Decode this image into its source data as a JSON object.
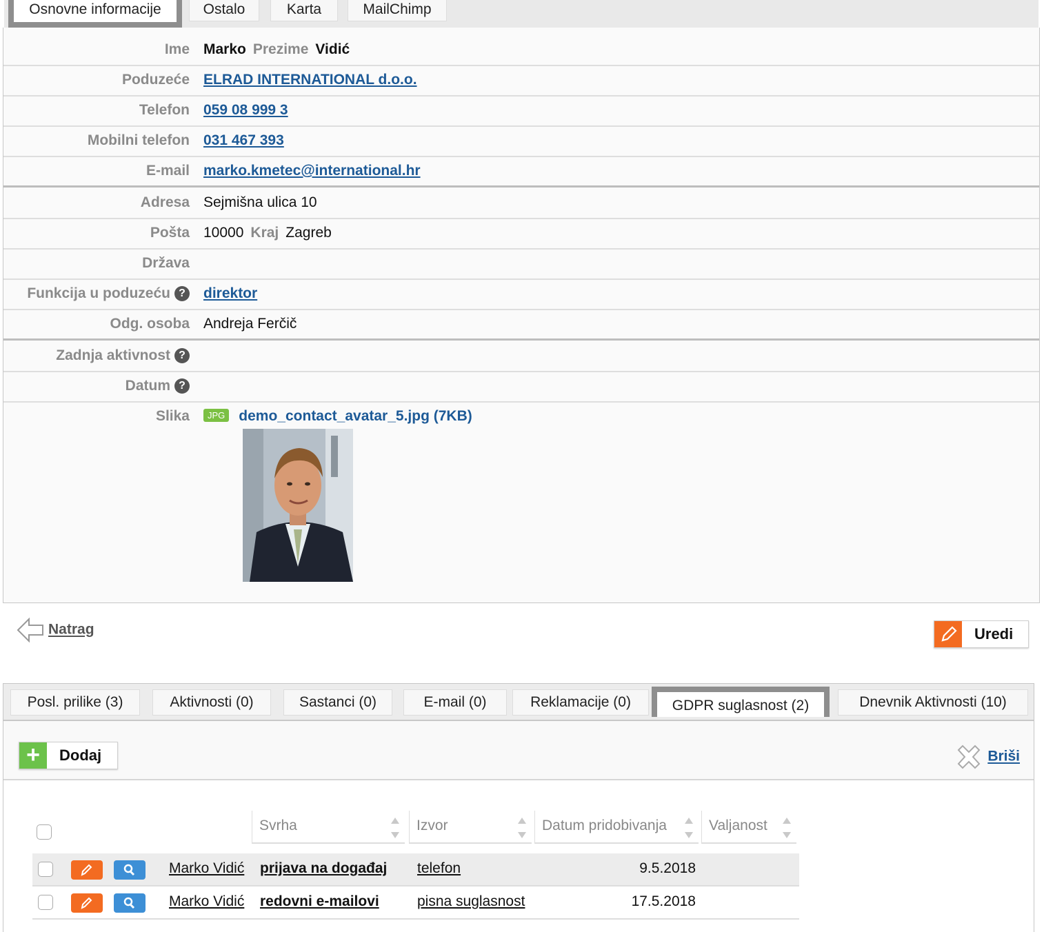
{
  "top_tabs": [
    "Osnovne informacije",
    "Ostalo",
    "Karta",
    "MailChimp"
  ],
  "contact": {
    "ime_label": "Ime",
    "ime": "Marko",
    "prezime_label": "Prezime",
    "prezime": "Vidić",
    "poduzece_label": "Poduzeće",
    "poduzece": "ELRAD INTERNATIONAL d.o.o.",
    "telefon_label": "Telefon",
    "telefon": "059 08 999 3",
    "mobilni_label": "Mobilni telefon",
    "mobilni": "031 467 393",
    "email_label": "E-mail",
    "email": "marko.kmetec@international.hr",
    "adresa_label": "Adresa",
    "adresa": "Sejmišna ulica 10",
    "posta_label": "Pošta",
    "posta": "10000",
    "kraj_label": "Kraj",
    "kraj": "Zagreb",
    "drzava_label": "Država",
    "funkcija_label": "Funkcija u poduzeću",
    "funkcija": "direktor",
    "odg_label": "Odg. osoba",
    "odg": "Andreja Ferčič",
    "zadnja_label": "Zadnja aktivnost",
    "datum_label": "Datum",
    "slika_label": "Slika",
    "slika_badge": "JPG",
    "slika_file": "demo_contact_avatar_5.jpg (7KB)"
  },
  "actions": {
    "back": "Natrag",
    "edit": "Uredi"
  },
  "bottom_tabs": [
    "Posl. prilike (3)",
    "Aktivnosti (0)",
    "Sastanci (0)",
    "E-mail (0)",
    "Reklamacije (0)",
    "GDPR suglasnost (2)",
    "Dnevnik Aktivnosti  (10)"
  ],
  "toolbar": {
    "add": "Dodaj",
    "delete": "Briši",
    "add_icon": "+"
  },
  "table": {
    "headers": [
      "Svrha",
      "Izvor",
      "Datum pridobivanja",
      "Valjanost"
    ],
    "rows": [
      {
        "contact": "Marko Vidić",
        "svrha": "prijava na događaj",
        "izvor": "telefon",
        "datum": "9.5.2018"
      },
      {
        "contact": "Marko Vidić",
        "svrha": "redovni e-mailovi",
        "izvor": "pisna suglasnost",
        "datum": "17.5.2018"
      }
    ]
  },
  "icons": {
    "help": "?",
    "edit": "pencil-icon",
    "view": "magnifier-icon",
    "back": "back-arrow-icon",
    "delete": "cross-icon"
  },
  "colors": {
    "link": "#1d5a97",
    "orange": "#f36b21",
    "blue": "#3d8fd6",
    "green": "#6cc24a"
  }
}
